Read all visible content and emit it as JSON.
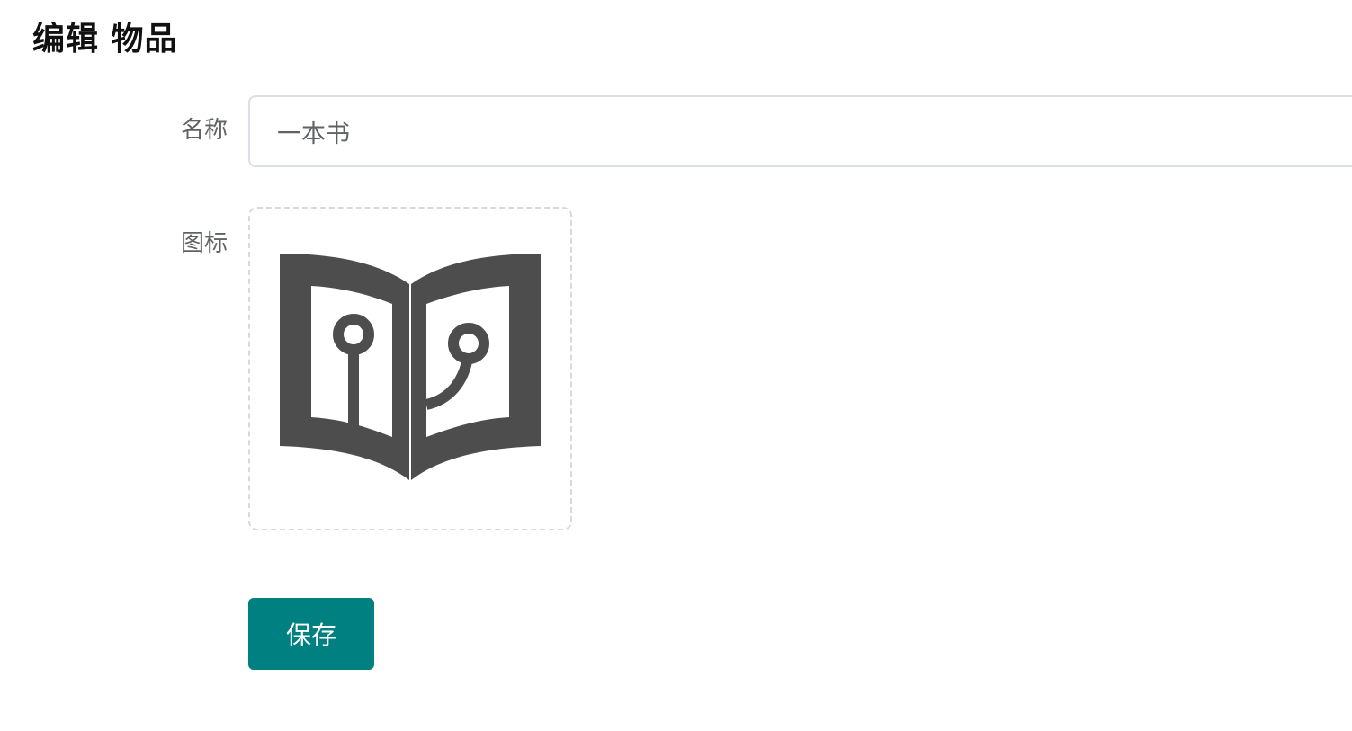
{
  "page": {
    "title": "编辑 物品"
  },
  "form": {
    "name_label": "名称",
    "name_value": "一本书",
    "icon_label": "图标",
    "icon_image": "open-book-circuit-icon",
    "save_label": "保存"
  },
  "colors": {
    "primary": "#008080",
    "icon_fill": "#4d4d4d",
    "label": "#606266",
    "border": "#dcdfe6"
  }
}
